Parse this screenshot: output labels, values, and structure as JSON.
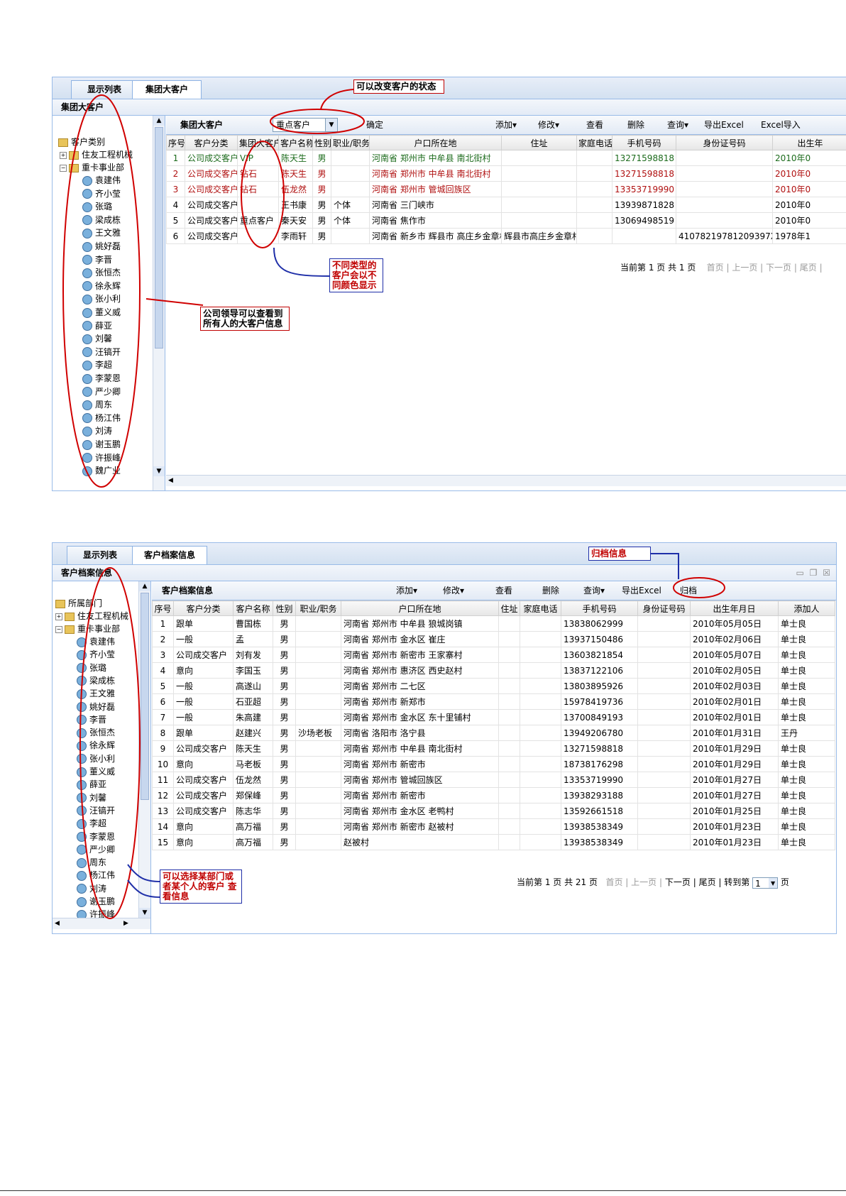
{
  "panel1": {
    "tabs": [
      "显示列表",
      "集团大客户"
    ],
    "title": "集团大客户",
    "tree_root": "客户类别",
    "tree_depts": [
      "住友工程机械",
      "重卡事业部"
    ],
    "tree_people": [
      "袁建伟",
      "齐小莹",
      "张璐",
      "梁成栋",
      "王文雅",
      "姚好磊",
      "李晋",
      "张恒杰",
      "徐永辉",
      "张小利",
      "董义威",
      "薛亚",
      "刘馨",
      "汪镐开",
      "李超",
      "李蒙恩",
      "严少卿",
      "周东",
      "杨江伟",
      "刘涛",
      "谢玉鹏",
      "许振峰",
      "魏广业"
    ],
    "toolbar": {
      "label": "集团大客户",
      "select_value": "重点客户",
      "confirm": "确定",
      "add": "添加",
      "edit": "修改",
      "view": "查看",
      "delete": "删除",
      "query": "查询",
      "export": "导出Excel",
      "import": "Excel导入"
    },
    "columns": [
      "序号",
      "客户分类",
      "集团大客户",
      "客户名称",
      "性别",
      "职业/职务",
      "户口所在地",
      "住址",
      "家庭电话",
      "手机号码",
      "身份证号码",
      "出生年"
    ],
    "rows": [
      {
        "no": "1",
        "category": "公司成交客户",
        "group": "VIP",
        "name": "陈天生",
        "sex": "男",
        "job": "",
        "hukou": "河南省 郑州市 中牟县 南北街村",
        "addr": "",
        "home": "",
        "mobile": "13271598818",
        "idno": "",
        "birth": "2010年0",
        "style": "green"
      },
      {
        "no": "2",
        "category": "公司成交客户",
        "group": "钻石",
        "name": "陈天生",
        "sex": "男",
        "job": "",
        "hukou": "河南省 郑州市 中牟县 南北街村",
        "addr": "",
        "home": "",
        "mobile": "13271598818",
        "idno": "",
        "birth": "2010年0",
        "style": "red"
      },
      {
        "no": "3",
        "category": "公司成交客户",
        "group": "钻石",
        "name": "伍龙然",
        "sex": "男",
        "job": "",
        "hukou": "河南省 郑州市 管城回族区",
        "addr": "",
        "home": "",
        "mobile": "13353719990",
        "idno": "",
        "birth": "2010年0",
        "style": "red"
      },
      {
        "no": "4",
        "category": "公司成交客户",
        "group": "",
        "name": "王书康",
        "sex": "男",
        "job": "个体",
        "hukou": "河南省 三门峡市",
        "addr": "",
        "home": "",
        "mobile": "13939871828",
        "idno": "",
        "birth": "2010年0",
        "style": ""
      },
      {
        "no": "5",
        "category": "公司成交客户",
        "group": "重点客户",
        "name": "秦天安",
        "sex": "男",
        "job": "个体",
        "hukou": "河南省 焦作市",
        "addr": "",
        "home": "",
        "mobile": "13069498519",
        "idno": "",
        "birth": "2010年0",
        "style": ""
      },
      {
        "no": "6",
        "category": "公司成交客户",
        "group": "",
        "name": "李雨轩",
        "sex": "男",
        "job": "",
        "hukou": "河南省 新乡市 辉县市 高庄乡金章村",
        "addr": "辉县市高庄乡金章村",
        "home": "",
        "mobile": "",
        "idno": "41078219781209397X",
        "birth": "1978年1",
        "style": ""
      }
    ],
    "pager": {
      "text": "当前第 1 页 共 1 页",
      "first": "首页",
      "prev": "上一页",
      "next": "下一页",
      "last": "尾页"
    }
  },
  "panel2": {
    "tabs": [
      "显示列表",
      "客户档案信息"
    ],
    "title": "客户档案信息",
    "win_controls": "▭ ❐ ☒",
    "tree_root": "所属部门",
    "tree_depts": [
      "住友工程机械",
      "重卡事业部"
    ],
    "tree_people": [
      "袁建伟",
      "齐小莹",
      "张璐",
      "梁成栋",
      "王文雅",
      "姚好磊",
      "李晋",
      "张恒杰",
      "徐永辉",
      "张小利",
      "董义威",
      "薛亚",
      "刘馨",
      "汪镐开",
      "李超",
      "李蒙恩",
      "严少卿",
      "周东",
      "杨江伟",
      "刘涛",
      "谢玉鹏",
      "许振峰"
    ],
    "toolbar": {
      "label": "客户档案信息",
      "add": "添加",
      "edit": "修改",
      "view": "查看",
      "delete": "删除",
      "query": "查询",
      "export": "导出Excel",
      "archive": "归档"
    },
    "columns": [
      "序号",
      "客户分类",
      "客户名称",
      "性别",
      "职业/职务",
      "户口所在地",
      "住址",
      "家庭电话",
      "手机号码",
      "身份证号码",
      "出生年月日",
      "添加人"
    ],
    "rows": [
      {
        "no": "1",
        "category": "跟单",
        "name": "曹国栋",
        "sex": "男",
        "job": "",
        "hukou": "河南省 郑州市 中牟县 狼城岗镇",
        "addr": "",
        "home": "",
        "mobile": "13838062999",
        "idno": "",
        "birth": "2010年05月05日",
        "adder": "单士良"
      },
      {
        "no": "2",
        "category": "一般",
        "name": "孟",
        "sex": "男",
        "job": "",
        "hukou": "河南省 郑州市 金水区 崔庄",
        "addr": "",
        "home": "",
        "mobile": "13937150486",
        "idno": "",
        "birth": "2010年02月06日",
        "adder": "单士良"
      },
      {
        "no": "3",
        "category": "公司成交客户",
        "name": "刘有发",
        "sex": "男",
        "job": "",
        "hukou": "河南省 郑州市 新密市 王家寨村",
        "addr": "",
        "home": "",
        "mobile": "13603821854",
        "idno": "",
        "birth": "2010年05月07日",
        "adder": "单士良"
      },
      {
        "no": "4",
        "category": "意向",
        "name": "李国玉",
        "sex": "男",
        "job": "",
        "hukou": "河南省 郑州市 惠济区 西史赵村",
        "addr": "",
        "home": "",
        "mobile": "13837122106",
        "idno": "",
        "birth": "2010年02月05日",
        "adder": "单士良"
      },
      {
        "no": "5",
        "category": "一般",
        "name": "高遂山",
        "sex": "男",
        "job": "",
        "hukou": "河南省 郑州市 二七区",
        "addr": "",
        "home": "",
        "mobile": "13803895926",
        "idno": "",
        "birth": "2010年02月03日",
        "adder": "单士良"
      },
      {
        "no": "6",
        "category": "一般",
        "name": "石亚超",
        "sex": "男",
        "job": "",
        "hukou": "河南省 郑州市 新郑市",
        "addr": "",
        "home": "",
        "mobile": "15978419736",
        "idno": "",
        "birth": "2010年02月01日",
        "adder": "单士良"
      },
      {
        "no": "7",
        "category": "一般",
        "name": "朱高建",
        "sex": "男",
        "job": "",
        "hukou": "河南省 郑州市 金水区 东十里铺村",
        "addr": "",
        "home": "",
        "mobile": "13700849193",
        "idno": "",
        "birth": "2010年02月01日",
        "adder": "单士良"
      },
      {
        "no": "8",
        "category": "跟单",
        "name": "赵建兴",
        "sex": "男",
        "job": "沙场老板",
        "hukou": "河南省 洛阳市 洛宁县",
        "addr": "",
        "home": "",
        "mobile": "13949206780",
        "idno": "",
        "birth": "2010年01月31日",
        "adder": "王丹"
      },
      {
        "no": "9",
        "category": "公司成交客户",
        "name": "陈天生",
        "sex": "男",
        "job": "",
        "hukou": "河南省 郑州市 中牟县 南北街村",
        "addr": "",
        "home": "",
        "mobile": "13271598818",
        "idno": "",
        "birth": "2010年01月29日",
        "adder": "单士良"
      },
      {
        "no": "10",
        "category": "意向",
        "name": "马老板",
        "sex": "男",
        "job": "",
        "hukou": "河南省 郑州市 新密市",
        "addr": "",
        "home": "",
        "mobile": "18738176298",
        "idno": "",
        "birth": "2010年01月29日",
        "adder": "单士良"
      },
      {
        "no": "11",
        "category": "公司成交客户",
        "name": "伍龙然",
        "sex": "男",
        "job": "",
        "hukou": "河南省 郑州市 管城回族区",
        "addr": "",
        "home": "",
        "mobile": "13353719990",
        "idno": "",
        "birth": "2010年01月27日",
        "adder": "单士良"
      },
      {
        "no": "12",
        "category": "公司成交客户",
        "name": "郑保峰",
        "sex": "男",
        "job": "",
        "hukou": "河南省 郑州市 新密市",
        "addr": "",
        "home": "",
        "mobile": "13938293188",
        "idno": "",
        "birth": "2010年01月27日",
        "adder": "单士良"
      },
      {
        "no": "13",
        "category": "公司成交客户",
        "name": "陈志华",
        "sex": "男",
        "job": "",
        "hukou": "河南省 郑州市 金水区 老鸭村",
        "addr": "",
        "home": "",
        "mobile": "13592661518",
        "idno": "",
        "birth": "2010年01月25日",
        "adder": "单士良"
      },
      {
        "no": "14",
        "category": "意向",
        "name": "高万福",
        "sex": "男",
        "job": "",
        "hukou": "河南省 郑州市 新密市 赵被村",
        "addr": "",
        "home": "",
        "mobile": "13938538349",
        "idno": "",
        "birth": "2010年01月23日",
        "adder": "单士良"
      },
      {
        "no": "15",
        "category": "意向",
        "name": "高万福",
        "sex": "男",
        "job": "",
        "hukou": "赵被村",
        "addr": "",
        "home": "",
        "mobile": "13938538349",
        "idno": "",
        "birth": "2010年01月23日",
        "adder": "单士良"
      }
    ],
    "pager": {
      "text": "当前第 1 页 共 21 页",
      "first": "首页",
      "prev": "上一页",
      "next": "下一页",
      "last": "尾页",
      "goto": "转到第",
      "page_value": "1",
      "page_unit": "页"
    }
  },
  "annotations": {
    "status_note": "可以改变客户的状态",
    "color_note": "不同类型的客户会以不同颜色显示",
    "leader_note": "公司领导可以查看到所有人的大客户信息",
    "archive_note": "归档信息",
    "select_note": "可以选择某部门或者某个人的客户 查看信息"
  },
  "colors": {
    "green_row": "#1c6b1c",
    "red_row": "#b01010",
    "note_red": "#c00000",
    "note_blue": "#1f2fa8",
    "border": "#99bbe8"
  }
}
